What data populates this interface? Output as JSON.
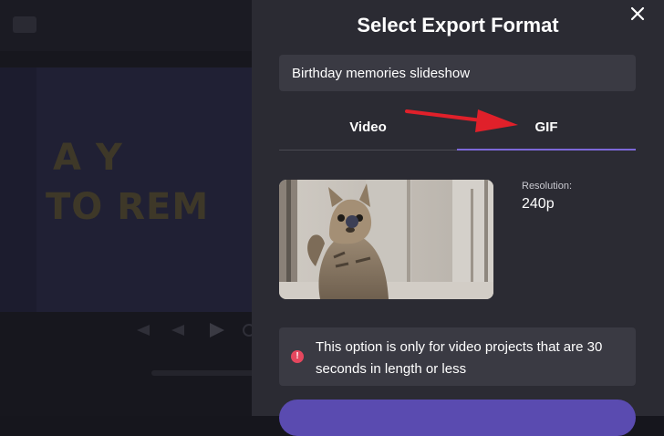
{
  "editor": {
    "preview_title_line1": "A Y",
    "preview_title_line2": "TO REM"
  },
  "dialog": {
    "title": "Select Export Format",
    "name_value": "Birthday memories slideshow",
    "tabs": [
      {
        "label": "Video",
        "active": false
      },
      {
        "label": "GIF",
        "active": true
      }
    ],
    "resolution_label": "Resolution:",
    "resolution_value": "240p",
    "notice_text": "This option is only for video projects that are 30 seconds in length or less",
    "notice_icon": "!"
  },
  "colors": {
    "panel_bg": "#2b2b33",
    "accent": "#7c68d8",
    "warning": "#e5475e",
    "annotation_arrow": "#e0202a"
  },
  "icons": {
    "close": "close-icon",
    "warning": "warning-icon",
    "annotation": "red-arrow-annotation"
  }
}
